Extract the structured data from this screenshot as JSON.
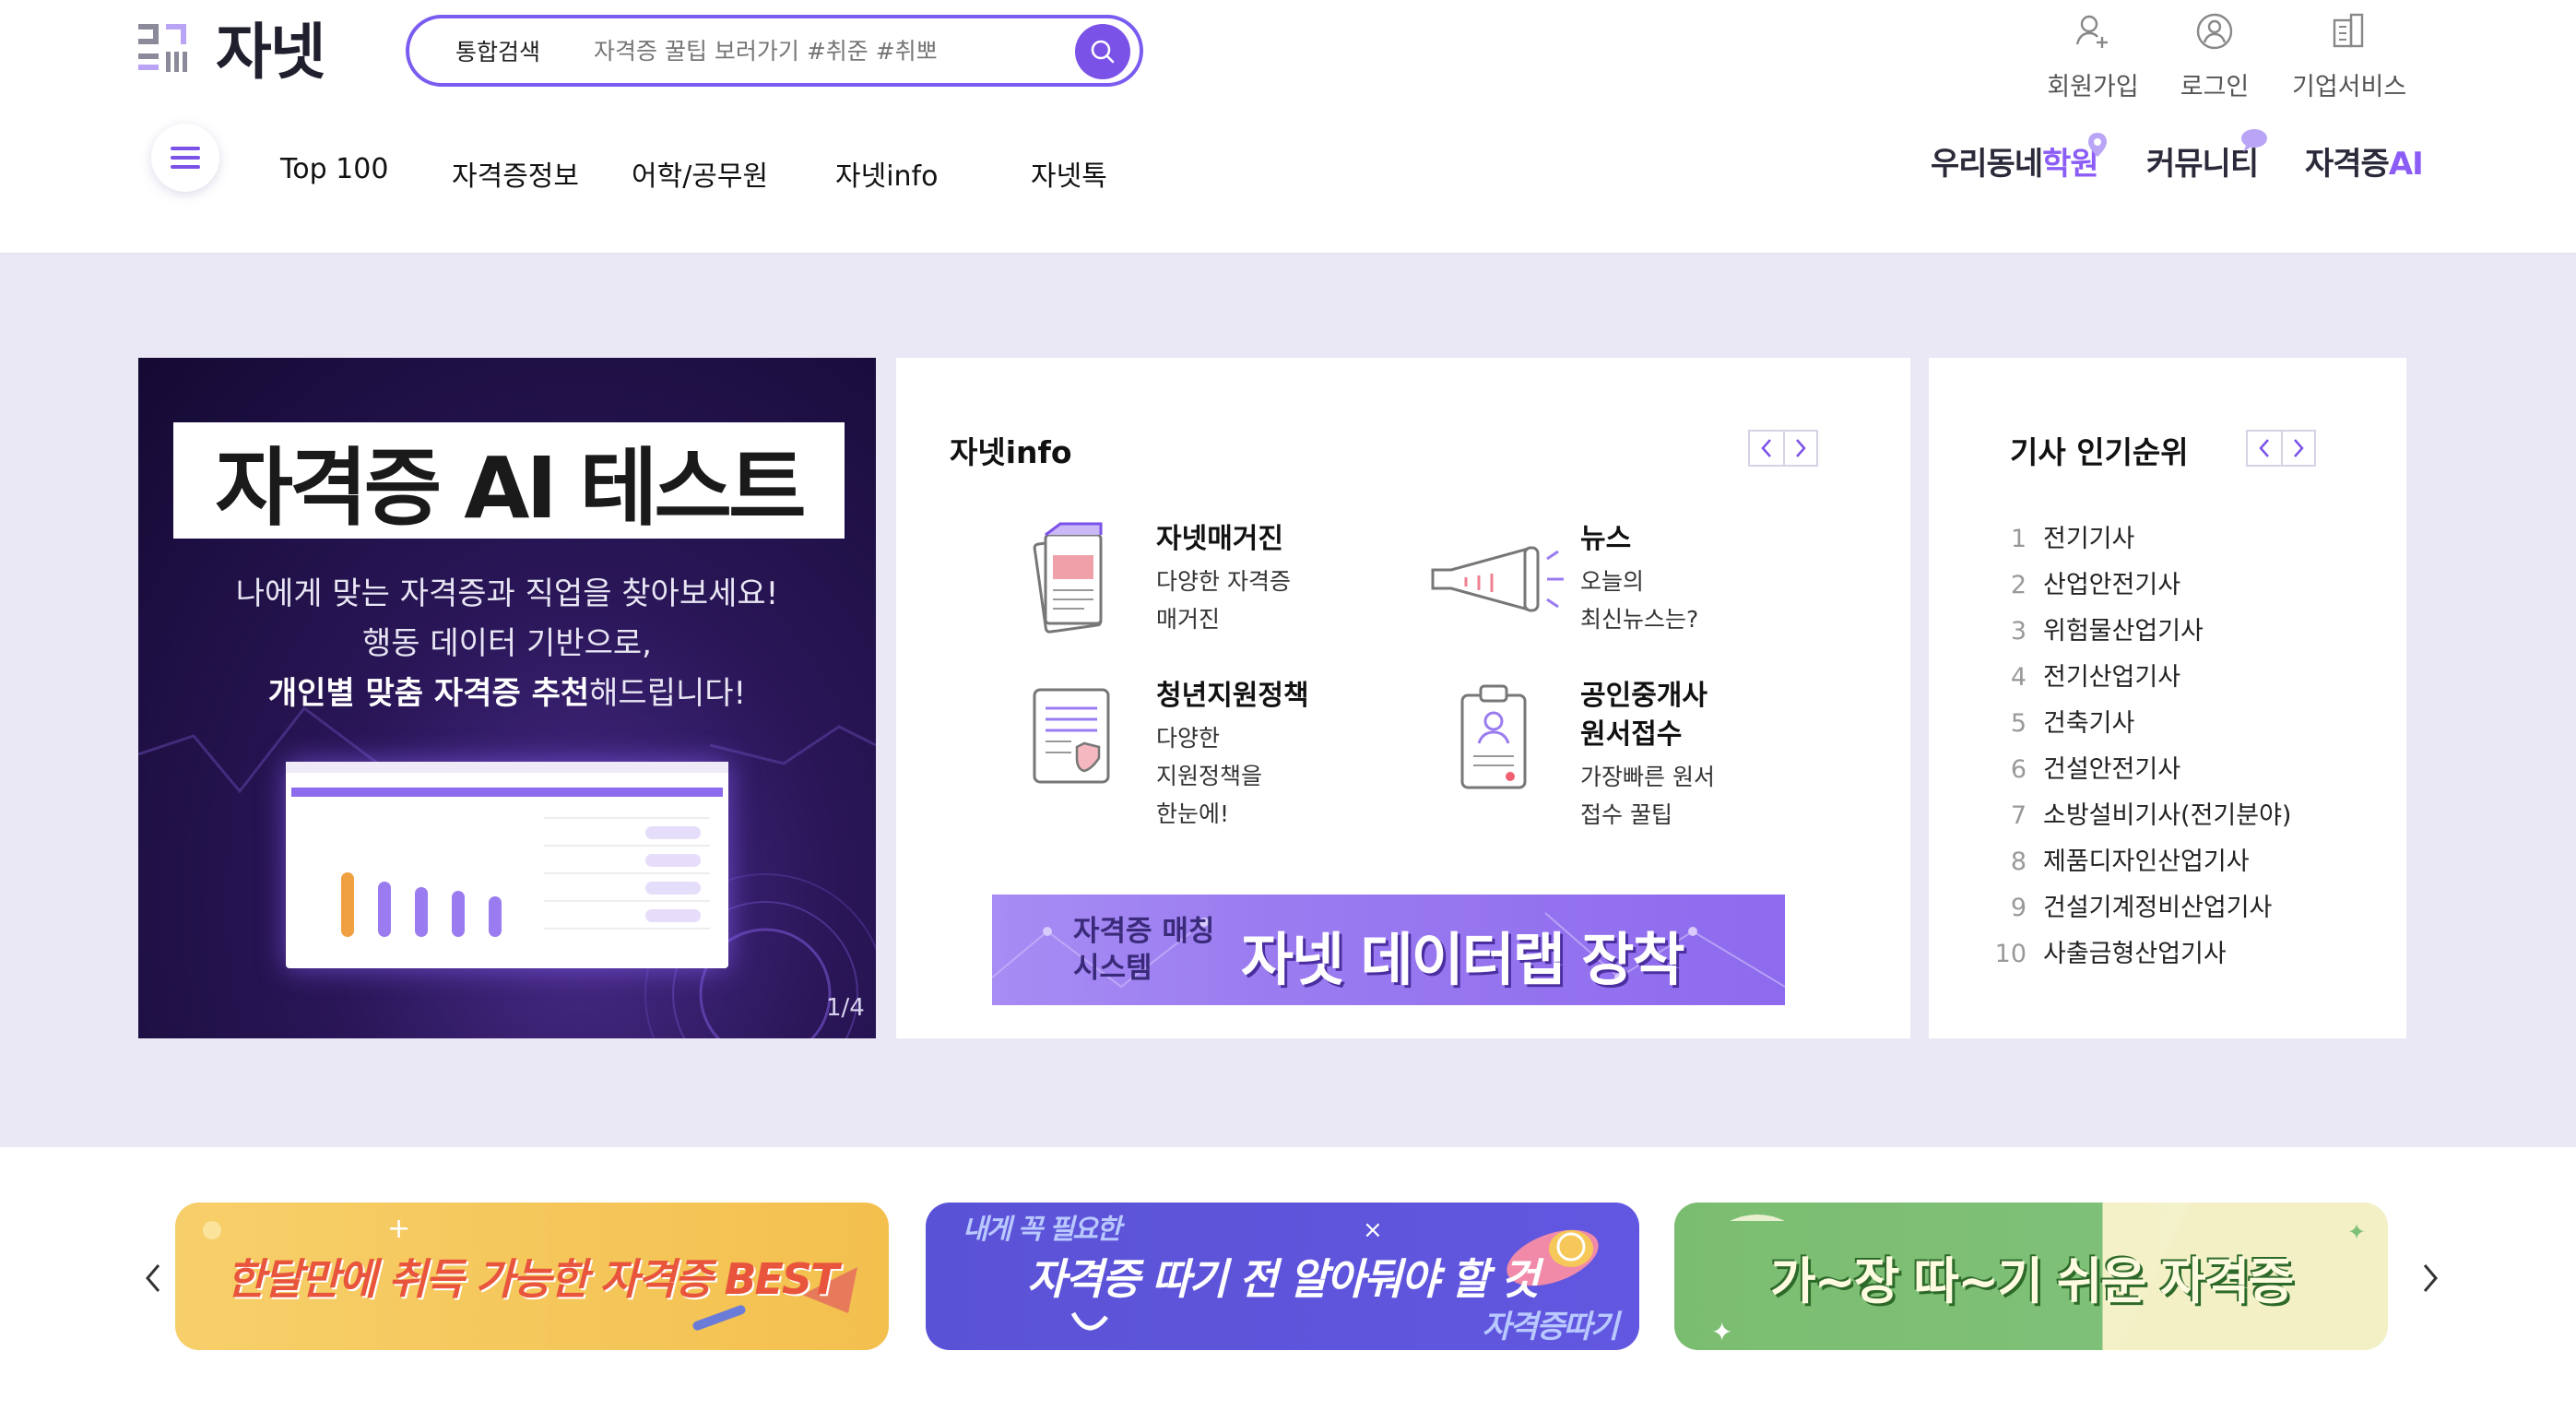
{
  "header": {
    "logo_text": "자넷",
    "search": {
      "category": "통합검색",
      "placeholder": "자격증 꿀팁 보러가기 #취준 #취뽀"
    },
    "utility": [
      {
        "label": "회원가입",
        "icon": "user-plus-icon"
      },
      {
        "label": "로그인",
        "icon": "user-circle-icon"
      },
      {
        "label": "기업서비스",
        "icon": "building-icon"
      }
    ],
    "nav": [
      "Top 100",
      "자격증정보",
      "어학/공무원",
      "자넷info",
      "자넷톡"
    ],
    "right_links": [
      {
        "pre": "우리동네",
        "hl": "학원"
      },
      {
        "pre": "커뮤니티",
        "hl": ""
      },
      {
        "pre": "자격증",
        "hl": "AI"
      }
    ]
  },
  "hero_banner": {
    "title": "자격증 AI 테스트",
    "line1": "나에게 맞는 자격증과 직업을 찾아보세요!",
    "line2": "행동 데이터 기반으로,",
    "line3_bold": "개인별 맞춤 자격증 추천",
    "line3_rest": "해드립니다!",
    "page": "1/4"
  },
  "info": {
    "title": "자넷info",
    "items": [
      {
        "title": "자넷매거진",
        "desc": [
          "다양한 자격증",
          "매거진"
        ],
        "icon": "magazine-icon"
      },
      {
        "title": "뉴스",
        "desc": [
          "오늘의",
          "최신뉴스는?"
        ],
        "icon": "megaphone-icon"
      },
      {
        "title": "청년지원정책",
        "desc": [
          "다양한",
          "지원정책을",
          "한눈에!"
        ],
        "icon": "policy-document-icon"
      },
      {
        "title": "공인중개사\n원서접수",
        "title1": "공인중개사",
        "title2": "원서접수",
        "desc": [
          "가장빠른 원서",
          "접수 꿀팁"
        ],
        "icon": "application-clipboard-icon"
      }
    ],
    "datalab": {
      "small1": "자격증 매칭",
      "small2": "시스템",
      "big": "자넷 데이터랩 장착"
    }
  },
  "ranking": {
    "title": "기사 인기순위",
    "items": [
      "전기기사",
      "산업안전기사",
      "위험물산업기사",
      "전기산업기사",
      "건축기사",
      "건설안전기사",
      "소방설비기사(전기분야)",
      "제품디자인산업기사",
      "건설기계정비산업기사",
      "사출금형산업기사"
    ]
  },
  "promos": [
    {
      "text": "한달만에 취득 가능한 자격증 BEST",
      "bg": "#f6c85a"
    },
    {
      "text": "자격증 따기 전 알아둬야 할 것",
      "sub": "내게 꼭 필요한",
      "tail": "자격증따기",
      "bg": "#5b4fd8"
    },
    {
      "text": "가~장 따~기 쉬운 자격증",
      "bg": "#7fc078"
    }
  ],
  "colors": {
    "accent": "#7b52e8",
    "hero_bg": "#ebe8f6"
  }
}
